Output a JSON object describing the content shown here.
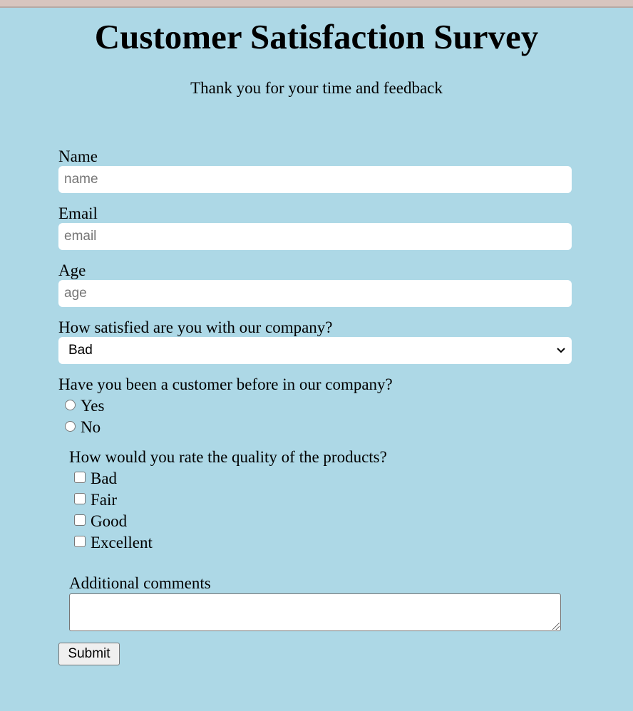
{
  "title": "Customer Satisfaction Survey",
  "subtitle": "Thank you for your time and feedback",
  "fields": {
    "name": {
      "label": "Name",
      "placeholder": "name"
    },
    "email": {
      "label": "Email",
      "placeholder": "email"
    },
    "age": {
      "label": "Age",
      "placeholder": "age"
    }
  },
  "satisfaction": {
    "label": "How satisfied are you with our company?",
    "selected": "Bad"
  },
  "customer_before": {
    "label": "Have you been a customer before in our company?",
    "options": [
      "Yes",
      "No"
    ]
  },
  "quality": {
    "label": "How would you rate the quality of the products?",
    "options": [
      "Bad",
      "Fair",
      "Good",
      "Excellent"
    ]
  },
  "comments": {
    "label": "Additional comments"
  },
  "submit_label": "Submit"
}
